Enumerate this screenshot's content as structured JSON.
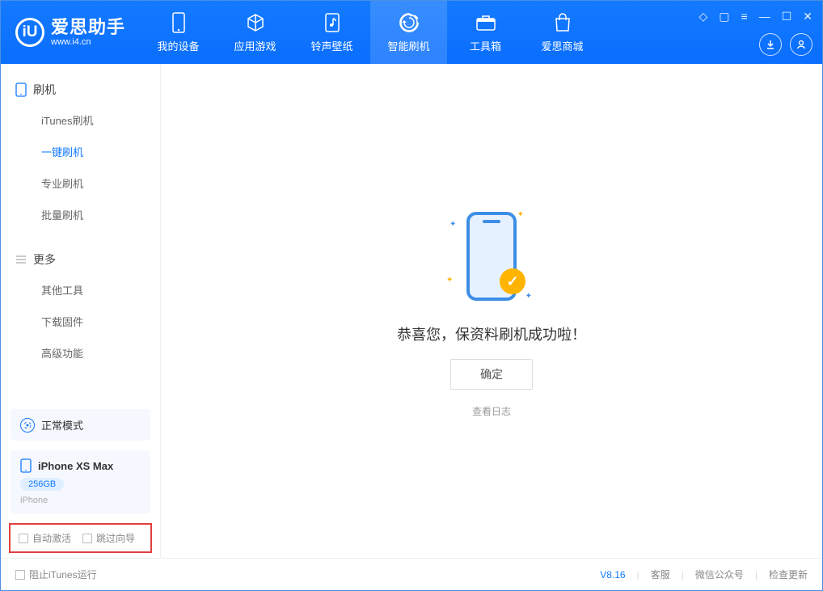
{
  "app": {
    "name": "爱思助手",
    "url": "www.i4.cn",
    "logo_letter": "iU"
  },
  "nav": [
    {
      "label": "我的设备",
      "icon": "device"
    },
    {
      "label": "应用游戏",
      "icon": "cube"
    },
    {
      "label": "铃声壁纸",
      "icon": "music"
    },
    {
      "label": "智能刷机",
      "icon": "refresh",
      "active": true
    },
    {
      "label": "工具箱",
      "icon": "toolbox"
    },
    {
      "label": "爱思商城",
      "icon": "bag"
    }
  ],
  "sidebar": {
    "section1": {
      "title": "刷机",
      "items": [
        "iTunes刷机",
        "一键刷机",
        "专业刷机",
        "批量刷机"
      ],
      "active_index": 1
    },
    "section2": {
      "title": "更多",
      "items": [
        "其他工具",
        "下载固件",
        "高级功能"
      ]
    },
    "mode": {
      "label": "正常模式"
    },
    "device": {
      "name": "iPhone XS Max",
      "storage": "256GB",
      "type": "iPhone"
    },
    "options": {
      "opt1": "自动激活",
      "opt2": "跳过向导"
    }
  },
  "main": {
    "message": "恭喜您，保资料刷机成功啦！",
    "ok_button": "确定",
    "view_log": "查看日志"
  },
  "statusbar": {
    "stop_itunes": "阻止iTunes运行",
    "version": "V8.16",
    "links": [
      "客服",
      "微信公众号",
      "检查更新"
    ]
  }
}
